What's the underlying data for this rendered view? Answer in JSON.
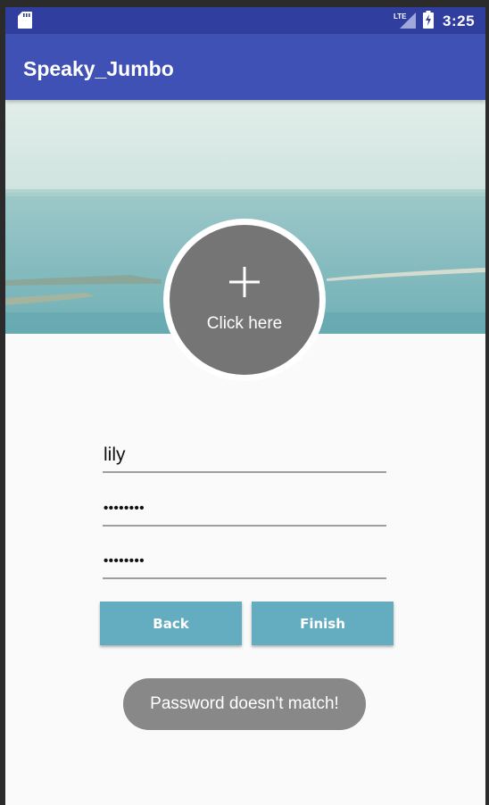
{
  "status_bar": {
    "time": "3:25",
    "network_label": "LTE",
    "icons": [
      "sd-card-icon",
      "lte-signal-icon",
      "battery-charging-icon"
    ]
  },
  "app_bar": {
    "title": "Speaky_Jumbo",
    "color": "#3f51b5"
  },
  "profile": {
    "add_photo_icon": "plus-icon",
    "add_photo_label": "Click here"
  },
  "form": {
    "username": "lily",
    "password_mask": "••••••••",
    "confirm_password_mask": "••••••••"
  },
  "buttons": {
    "back_label": "Back",
    "finish_label": "Finish",
    "color": "#64adc0"
  },
  "toast": {
    "message": "Password doesn't match!"
  }
}
